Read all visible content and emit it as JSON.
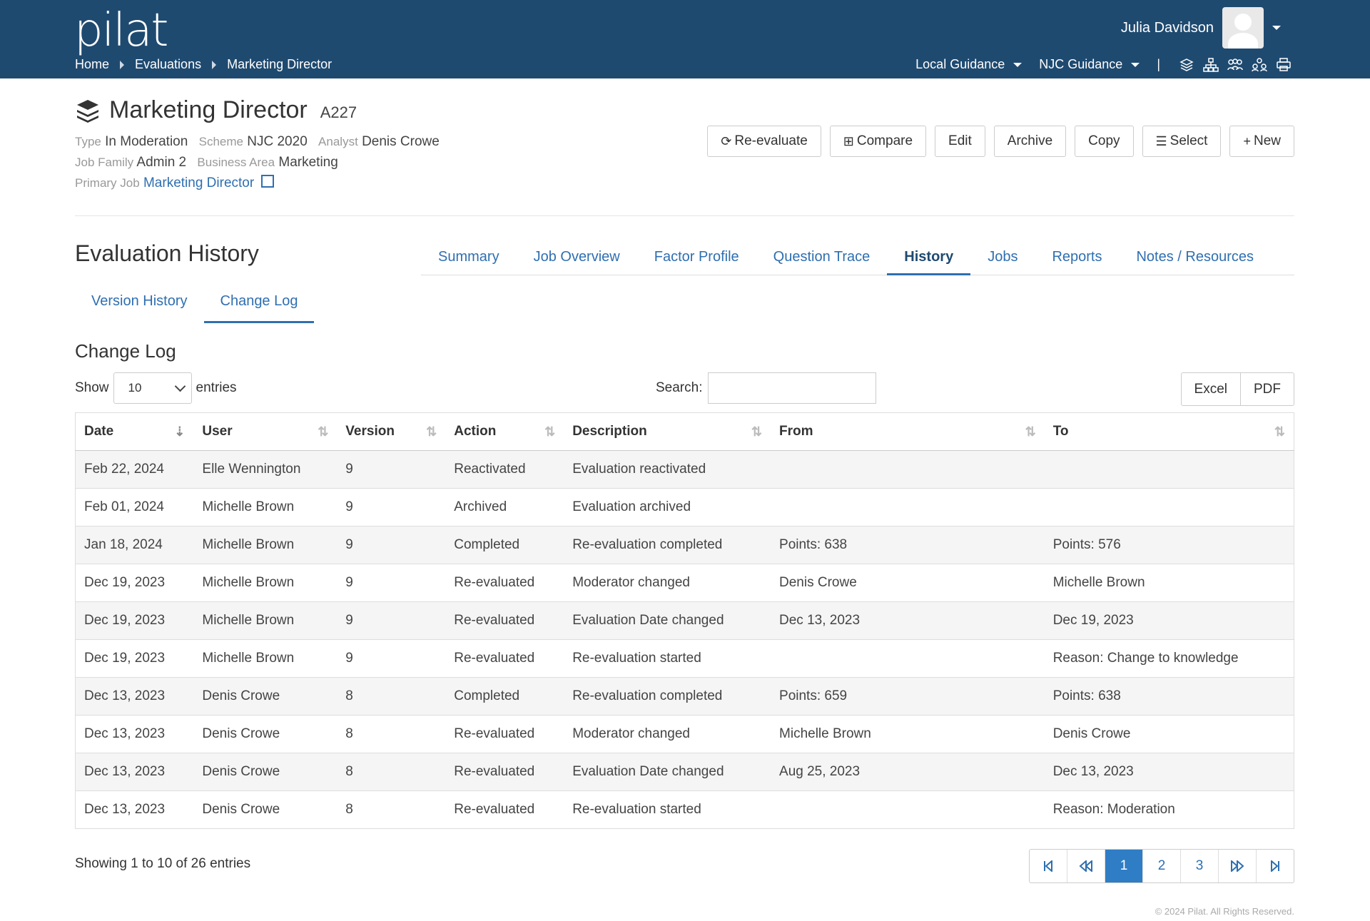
{
  "app": {
    "logo": "pilat"
  },
  "breadcrumb": [
    "Home",
    "Evaluations",
    "Marketing Director"
  ],
  "user": {
    "name": "Julia Davidson"
  },
  "guides": [
    "Local Guidance",
    "NJC Guidance"
  ],
  "header_icons": [
    "layers-icon",
    "org-chart-icon",
    "users-icon",
    "group-icon",
    "print-icon"
  ],
  "evaluation": {
    "title": "Marketing Director",
    "code": "A227",
    "type_label": "Type",
    "type": "In Moderation",
    "scheme_label": "Scheme",
    "scheme": "NJC 2020",
    "analyst_label": "Analyst",
    "analyst": "Denis Crowe",
    "family_label": "Job Family",
    "family": "Admin 2",
    "area_label": "Business Area",
    "area": "Marketing",
    "primary_label": "Primary Job",
    "primary": "Marketing Director"
  },
  "actions": [
    "Re-evaluate",
    "Compare",
    "Edit",
    "Archive",
    "Copy",
    "Select",
    "New"
  ],
  "section_title": "Evaluation History",
  "tabs": [
    "Summary",
    "Job Overview",
    "Factor Profile",
    "Question Trace",
    "History",
    "Jobs",
    "Reports",
    "Notes / Resources"
  ],
  "active_tab": "History",
  "subtabs": [
    "Version History",
    "Change Log"
  ],
  "changelog": {
    "title": "Change Log",
    "show_label": "Show",
    "show_value": "10",
    "entries_label": "entries",
    "search_label": "Search:",
    "export": [
      "Excel",
      "PDF"
    ],
    "columns": [
      "Date",
      "User",
      "Version",
      "Action",
      "Description",
      "From",
      "To"
    ],
    "rows": [
      [
        "Feb 22, 2024",
        "Elle Wennington",
        "9",
        "Reactivated",
        "Evaluation reactivated",
        "",
        ""
      ],
      [
        "Feb 01, 2024",
        "Michelle Brown",
        "9",
        "Archived",
        "Evaluation archived",
        "",
        ""
      ],
      [
        "Jan 18, 2024",
        "Michelle Brown",
        "9",
        "Completed",
        "Re-evaluation completed",
        "Points: 638",
        "Points: 576"
      ],
      [
        "Dec 19, 2023",
        "Michelle Brown",
        "9",
        "Re-evaluated",
        "Moderator changed",
        "Denis Crowe",
        "Michelle Brown"
      ],
      [
        "Dec 19, 2023",
        "Michelle Brown",
        "9",
        "Re-evaluated",
        "Evaluation Date changed",
        "Dec 13, 2023",
        "Dec 19, 2023"
      ],
      [
        "Dec 19, 2023",
        "Michelle Brown",
        "9",
        "Re-evaluated",
        "Re-evaluation started",
        "",
        "Reason: Change to knowledge"
      ],
      [
        "Dec 13, 2023",
        "Denis Crowe",
        "8",
        "Completed",
        "Re-evaluation completed",
        "Points: 659",
        "Points: 638"
      ],
      [
        "Dec 13, 2023",
        "Denis Crowe",
        "8",
        "Re-evaluated",
        "Moderator changed",
        "Michelle Brown",
        "Denis Crowe"
      ],
      [
        "Dec 13, 2023",
        "Denis Crowe",
        "8",
        "Re-evaluated",
        "Evaluation Date changed",
        "Aug 25, 2023",
        "Dec 13, 2023"
      ],
      [
        "Dec 13, 2023",
        "Denis Crowe",
        "8",
        "Re-evaluated",
        "Re-evaluation started",
        "",
        "Reason: Moderation"
      ]
    ],
    "info": "Showing 1 to 10 of 26 entries",
    "pages": [
      "1",
      "2",
      "3"
    ]
  },
  "footer": "© 2024 Pilat. All Rights Reserved."
}
